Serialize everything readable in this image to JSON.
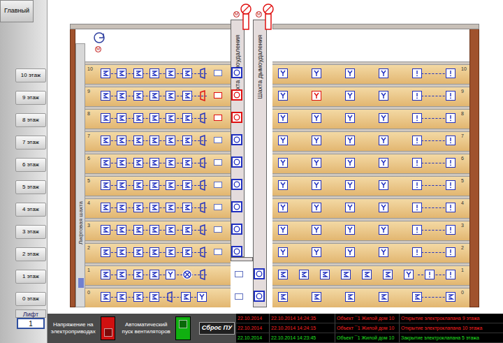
{
  "nav": {
    "main": "Главный",
    "floors": [
      {
        "label": "10 этаж"
      },
      {
        "label": "9 этаж"
      },
      {
        "label": "8 этаж"
      },
      {
        "label": "7 этаж"
      },
      {
        "label": "6 этаж"
      },
      {
        "label": "5 этаж"
      },
      {
        "label": "4 этаж"
      },
      {
        "label": "3 этаж"
      },
      {
        "label": "2 этаж"
      },
      {
        "label": "1 этаж"
      },
      {
        "label": "0 этаж"
      }
    ],
    "lift_label": "Лифт",
    "lift_value": "1"
  },
  "fans": [
    {
      "label": "M",
      "alarm": true
    },
    {
      "label": "M",
      "alarm": true
    },
    {
      "label": "M",
      "alarm": false
    }
  ],
  "building": {
    "shaft_labels": [
      "Шахта дымоудаления",
      "Шахта дымоудаления"
    ],
    "lift_shaft": "Лифтовая шахта",
    "floors": [
      {
        "number": "10",
        "valve_alarm": false,
        "left": [
          {
            "kind": "smoke",
            "alarm": false
          },
          {
            "kind": "smoke",
            "alarm": false
          },
          {
            "kind": "smoke",
            "alarm": false
          },
          {
            "kind": "smoke",
            "alarm": false
          },
          {
            "kind": "smoke",
            "alarm": false
          },
          {
            "kind": "smoke",
            "alarm": false
          },
          {
            "kind": "sounder",
            "alarm": false
          }
        ],
        "right": [
          {
            "kind": "heat",
            "alarm": false
          },
          {
            "kind": "heat",
            "alarm": false
          },
          {
            "kind": "heat",
            "alarm": false
          },
          {
            "kind": "heat",
            "alarm": false
          },
          {
            "kind": "manual",
            "alarm": false
          },
          {
            "kind": "manual",
            "alarm": false
          }
        ]
      },
      {
        "number": "9",
        "valve_alarm": true,
        "left": [
          {
            "kind": "smoke",
            "alarm": false
          },
          {
            "kind": "smoke",
            "alarm": false
          },
          {
            "kind": "smoke",
            "alarm": false
          },
          {
            "kind": "smoke",
            "alarm": false
          },
          {
            "kind": "smoke",
            "alarm": false
          },
          {
            "kind": "smoke",
            "alarm": false
          },
          {
            "kind": "sounder",
            "alarm": true
          }
        ],
        "right": [
          {
            "kind": "heat",
            "alarm": false
          },
          {
            "kind": "heat",
            "alarm": true
          },
          {
            "kind": "heat",
            "alarm": false
          },
          {
            "kind": "heat",
            "alarm": false
          },
          {
            "kind": "manual",
            "alarm": false
          },
          {
            "kind": "manual",
            "alarm": false
          }
        ]
      },
      {
        "number": "8",
        "valve_alarm": true,
        "left": [
          {
            "kind": "smoke",
            "alarm": false
          },
          {
            "kind": "smoke",
            "alarm": false
          },
          {
            "kind": "smoke",
            "alarm": false
          },
          {
            "kind": "smoke",
            "alarm": false
          },
          {
            "kind": "smoke",
            "alarm": false
          },
          {
            "kind": "smoke",
            "alarm": false
          },
          {
            "kind": "sounder",
            "alarm": false
          }
        ],
        "right": [
          {
            "kind": "heat",
            "alarm": false
          },
          {
            "kind": "heat",
            "alarm": false
          },
          {
            "kind": "heat",
            "alarm": false
          },
          {
            "kind": "heat",
            "alarm": false
          },
          {
            "kind": "manual",
            "alarm": false
          },
          {
            "kind": "manual",
            "alarm": false
          }
        ]
      },
      {
        "number": "7",
        "valve_alarm": false,
        "left": [
          {
            "kind": "smoke",
            "alarm": false
          },
          {
            "kind": "smoke",
            "alarm": false
          },
          {
            "kind": "smoke",
            "alarm": false
          },
          {
            "kind": "smoke",
            "alarm": false
          },
          {
            "kind": "smoke",
            "alarm": false
          },
          {
            "kind": "smoke",
            "alarm": false
          },
          {
            "kind": "sounder",
            "alarm": false
          }
        ],
        "right": [
          {
            "kind": "heat",
            "alarm": false
          },
          {
            "kind": "heat",
            "alarm": false
          },
          {
            "kind": "heat",
            "alarm": false
          },
          {
            "kind": "heat",
            "alarm": false
          },
          {
            "kind": "manual",
            "alarm": false
          },
          {
            "kind": "manual",
            "alarm": false
          }
        ]
      },
      {
        "number": "6",
        "valve_alarm": false,
        "left": [
          {
            "kind": "smoke",
            "alarm": false
          },
          {
            "kind": "smoke",
            "alarm": false
          },
          {
            "kind": "smoke",
            "alarm": false
          },
          {
            "kind": "smoke",
            "alarm": false
          },
          {
            "kind": "smoke",
            "alarm": false
          },
          {
            "kind": "smoke",
            "alarm": false
          },
          {
            "kind": "sounder",
            "alarm": false
          }
        ],
        "right": [
          {
            "kind": "heat",
            "alarm": false
          },
          {
            "kind": "heat",
            "alarm": false
          },
          {
            "kind": "heat",
            "alarm": false
          },
          {
            "kind": "heat",
            "alarm": false
          },
          {
            "kind": "manual",
            "alarm": false
          },
          {
            "kind": "manual",
            "alarm": false
          }
        ]
      },
      {
        "number": "5",
        "valve_alarm": false,
        "left": [
          {
            "kind": "smoke",
            "alarm": false
          },
          {
            "kind": "smoke",
            "alarm": false
          },
          {
            "kind": "smoke",
            "alarm": false
          },
          {
            "kind": "smoke",
            "alarm": false
          },
          {
            "kind": "smoke",
            "alarm": false
          },
          {
            "kind": "smoke",
            "alarm": false
          },
          {
            "kind": "sounder",
            "alarm": false
          }
        ],
        "right": [
          {
            "kind": "heat",
            "alarm": false
          },
          {
            "kind": "heat",
            "alarm": false
          },
          {
            "kind": "heat",
            "alarm": false
          },
          {
            "kind": "heat",
            "alarm": false
          },
          {
            "kind": "manual",
            "alarm": false
          },
          {
            "kind": "manual",
            "alarm": false
          }
        ]
      },
      {
        "number": "4",
        "valve_alarm": false,
        "left": [
          {
            "kind": "smoke",
            "alarm": false
          },
          {
            "kind": "smoke",
            "alarm": false
          },
          {
            "kind": "smoke",
            "alarm": false
          },
          {
            "kind": "smoke",
            "alarm": false
          },
          {
            "kind": "smoke",
            "alarm": false
          },
          {
            "kind": "smoke",
            "alarm": false
          },
          {
            "kind": "sounder",
            "alarm": false
          }
        ],
        "right": [
          {
            "kind": "heat",
            "alarm": false
          },
          {
            "kind": "heat",
            "alarm": false
          },
          {
            "kind": "heat",
            "alarm": false
          },
          {
            "kind": "heat",
            "alarm": false
          },
          {
            "kind": "manual",
            "alarm": false
          },
          {
            "kind": "manual",
            "alarm": false
          }
        ]
      },
      {
        "number": "3",
        "valve_alarm": false,
        "left": [
          {
            "kind": "smoke",
            "alarm": false
          },
          {
            "kind": "smoke",
            "alarm": false
          },
          {
            "kind": "smoke",
            "alarm": false
          },
          {
            "kind": "smoke",
            "alarm": false
          },
          {
            "kind": "smoke",
            "alarm": false
          },
          {
            "kind": "smoke",
            "alarm": false
          },
          {
            "kind": "sounder",
            "alarm": false
          }
        ],
        "right": [
          {
            "kind": "heat",
            "alarm": false
          },
          {
            "kind": "heat",
            "alarm": false
          },
          {
            "kind": "heat",
            "alarm": false
          },
          {
            "kind": "heat",
            "alarm": false
          },
          {
            "kind": "manual",
            "alarm": false
          },
          {
            "kind": "manual",
            "alarm": false
          }
        ]
      },
      {
        "number": "2",
        "valve_alarm": false,
        "left": [
          {
            "kind": "smoke",
            "alarm": false
          },
          {
            "kind": "smoke",
            "alarm": false
          },
          {
            "kind": "smoke",
            "alarm": false
          },
          {
            "kind": "smoke",
            "alarm": false
          },
          {
            "kind": "smoke",
            "alarm": false
          },
          {
            "kind": "smoke",
            "alarm": false
          },
          {
            "kind": "sounder",
            "alarm": false
          }
        ],
        "right": [
          {
            "kind": "heat",
            "alarm": false
          },
          {
            "kind": "heat",
            "alarm": false
          },
          {
            "kind": "heat",
            "alarm": false
          },
          {
            "kind": "heat",
            "alarm": false
          },
          {
            "kind": "manual",
            "alarm": false
          },
          {
            "kind": "manual",
            "alarm": false
          }
        ]
      },
      {
        "number": "1",
        "valve_alarm": false,
        "left": [
          {
            "kind": "smoke",
            "alarm": false
          },
          {
            "kind": "smoke",
            "alarm": false
          },
          {
            "kind": "smoke",
            "alarm": false
          },
          {
            "kind": "smoke",
            "alarm": false
          },
          {
            "kind": "heat",
            "alarm": false
          },
          {
            "kind": "flow",
            "alarm": false
          },
          {
            "kind": "sounder",
            "alarm": false
          }
        ],
        "right": [
          {
            "kind": "smoke",
            "alarm": false
          },
          {
            "kind": "smoke",
            "alarm": false
          },
          {
            "kind": "smoke",
            "alarm": false
          },
          {
            "kind": "smoke",
            "alarm": false
          },
          {
            "kind": "smoke",
            "alarm": false
          },
          {
            "kind": "smoke",
            "alarm": false
          },
          {
            "kind": "heat",
            "alarm": false
          },
          {
            "kind": "manual",
            "alarm": false
          },
          {
            "kind": "manual",
            "alarm": false
          }
        ]
      },
      {
        "number": "0",
        "valve_alarm": false,
        "left": [
          {
            "kind": "smoke",
            "alarm": false
          },
          {
            "kind": "smoke",
            "alarm": false
          },
          {
            "kind": "smoke",
            "alarm": false
          },
          {
            "kind": "smoke",
            "alarm": false
          },
          {
            "kind": "sounder",
            "alarm": false
          },
          {
            "kind": "smoke",
            "alarm": false
          },
          {
            "kind": "heat",
            "alarm": false
          }
        ],
        "right": [
          {
            "kind": "smoke",
            "alarm": false
          },
          {
            "kind": "smoke",
            "alarm": false
          },
          {
            "kind": "smoke",
            "alarm": false
          },
          {
            "kind": "smoke",
            "alarm": false
          },
          {
            "kind": "smoke",
            "alarm": false
          },
          {
            "kind": "smoke",
            "alarm": false
          }
        ]
      }
    ]
  },
  "controls": {
    "power_label": "Напряжение на электроприводах",
    "power_on": false,
    "auto_label": "Автоматический пуск вентиляторов",
    "auto_on": true,
    "reset": "Сброс ПУ"
  },
  "events": [
    {
      "date": "22.10.2014",
      "time": "22.10.2014 14:24:35",
      "object": "Объект ¯1 Жилой дом 10",
      "message": "Открытие электроклапана 9 этажа",
      "color": "#ff2020"
    },
    {
      "date": "22.10.2014",
      "time": "22.10.2014 14:24:15",
      "object": "Объект ¯1 Жилой дом 10",
      "message": "Открытие электроклапана 10 этажа",
      "color": "#ff2020"
    },
    {
      "date": "22.10.2014",
      "time": "22.10.2014 14:23:45",
      "object": "Объект ¯1 Жилой дом 10",
      "message": "Закрытие электроклапана 5 этажа",
      "color": "#20e020"
    }
  ]
}
